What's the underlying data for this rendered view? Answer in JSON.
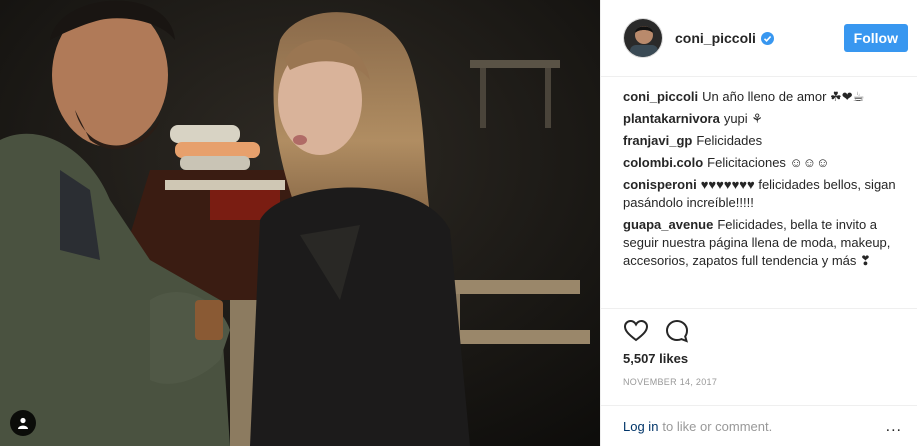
{
  "post": {
    "username": "coni_piccoli",
    "follow_label": "Follow",
    "likes": "5,507 likes",
    "date": "November 14, 2017",
    "login_link": "Log in",
    "login_suffix": "to like or comment.",
    "more": "..."
  },
  "comments": [
    {
      "user": "coni_piccoli",
      "text": "Un año lleno de amor ☘❤☕"
    },
    {
      "user": "plantakarnivora",
      "text": "yupi ⚘"
    },
    {
      "user": "franjavi_gp",
      "text": "Felicidades"
    },
    {
      "user": "colombi.colo",
      "text": "Felicitaciones ☺☺☺"
    },
    {
      "user": "conisperoni",
      "text": "♥♥♥♥♥♥♥ felicidades bellos, sigan pasándolo increíble!!!!!"
    },
    {
      "user": "guapa_avenue",
      "text": "Felicidades, bella te invito a seguir nuestra página llena de moda, makeup, accesorios, zapatos full tendencia y más ❣"
    }
  ],
  "colors": {
    "follow_button": "#3897f0",
    "verified_badge": "#3897f0",
    "link": "#003569",
    "muted": "#999999"
  },
  "icons": [
    "user-tag-icon",
    "verified-icon",
    "heart-icon",
    "comment-icon",
    "more-icon"
  ]
}
